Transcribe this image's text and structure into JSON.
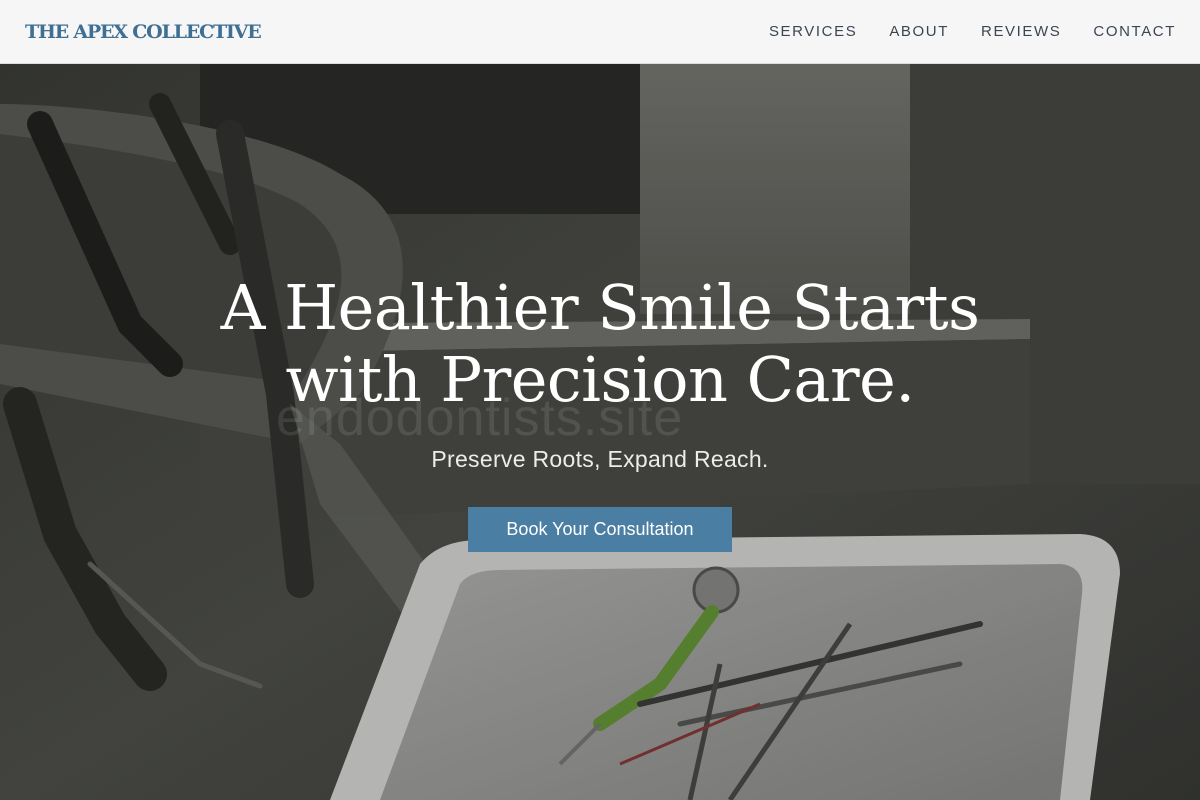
{
  "header": {
    "brand": "THE APEX COLLECTIVE",
    "nav": [
      "SERVICES",
      "ABOUT",
      "REVIEWS",
      "CONTACT"
    ]
  },
  "hero": {
    "headline": "A Healthier Smile Starts with Precision Care.",
    "subheadline": "Preserve Roots, Expand Reach.",
    "cta_label": "Book Your Consultation",
    "watermark": "endodontists.site"
  },
  "colors": {
    "brand": "#3f6f92",
    "accent_button": "#4a7ea3",
    "header_bg": "#f6f6f6",
    "nav_text": "#3b4652"
  }
}
